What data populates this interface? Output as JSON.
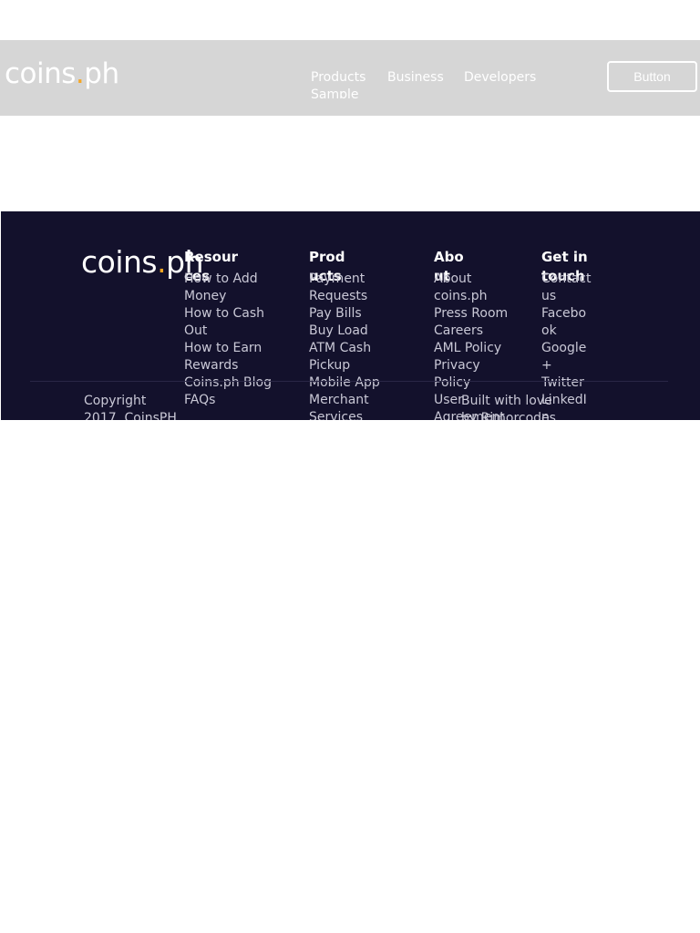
{
  "header": {
    "logo": {
      "text_main": "coins",
      "text_dot": ".",
      "text_tail": "ph"
    },
    "nav": [
      "Products",
      "Business",
      "Developers"
    ],
    "nav_sub": "Sample",
    "button_label": "Button"
  },
  "footer": {
    "logo": {
      "text_main": "coins",
      "text_dot": ".",
      "text_tail": "ph"
    },
    "columns": [
      {
        "title": "Resources",
        "items": [
          "How to Add Money",
          "How to Cash Out",
          "How to Earn Rewards",
          "Coins.ph Blog",
          "FAQs"
        ]
      },
      {
        "title": "Products",
        "items": [
          "Payment Requests",
          "Pay Bills",
          "Buy Load",
          "ATM Cash Pickup",
          "Mobile App",
          "Merchant Services"
        ]
      },
      {
        "title": "About",
        "items": [
          "About coins.ph",
          "Press Room",
          "Careers",
          "AML Policy",
          "Privacy Policy",
          "User Agreement"
        ]
      },
      {
        "title": "Get in touch",
        "items": [
          "Contact us",
          "Facebook",
          "Google +",
          "Twitter",
          "LinkedIn"
        ]
      }
    ],
    "copyright": "Copyright 2017. CoinsPH",
    "built_by": "Built with love by Rimorcodes Inc."
  },
  "colors": {
    "topbar_bg": "#d6d6d6",
    "footer_bg": "#13112c",
    "logo_dot": "#f5a623"
  }
}
